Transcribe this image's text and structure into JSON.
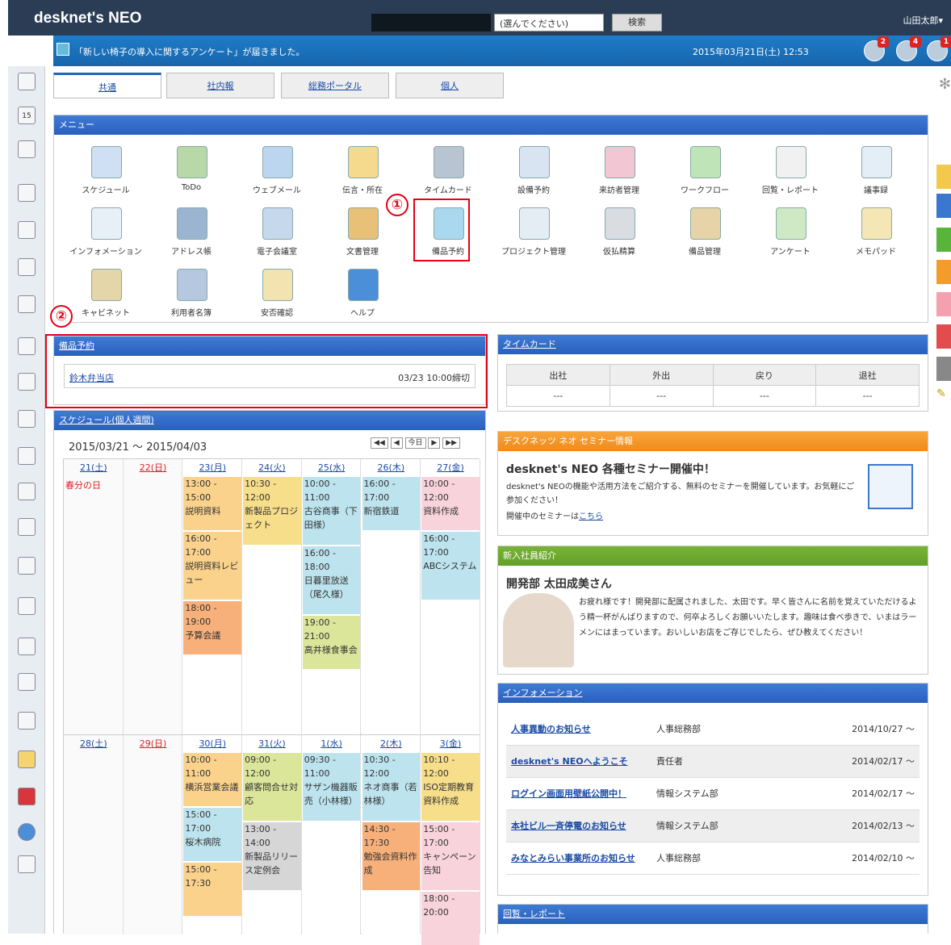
{
  "app": {
    "logo": "desknet's NEO",
    "search_select": "(選んでください)",
    "search_button": "検索",
    "user": "山田太郎▾"
  },
  "notice": {
    "message": "「新しい椅子の導入に関するアンケート」が届きました。",
    "datetime": "2015年03月21日(土) 12:53",
    "badges": [
      "2",
      "4",
      "1"
    ]
  },
  "tabs": [
    "共通",
    "社内報",
    "総務ポータル",
    "個人"
  ],
  "menu": {
    "title": "メニュー",
    "items": [
      {
        "label": "スケジュール",
        "color": "#cfe0f5"
      },
      {
        "label": "ToDo",
        "color": "#b9d8a8"
      },
      {
        "label": "ウェブメール",
        "color": "#bcd6ef"
      },
      {
        "label": "伝言・所在",
        "color": "#f5d98c"
      },
      {
        "label": "タイムカード",
        "color": "#b8c4d2"
      },
      {
        "label": "設備予約",
        "color": "#d8e4f2"
      },
      {
        "label": "来訪者管理",
        "color": "#f3c6d3"
      },
      {
        "label": "ワークフロー",
        "color": "#bfe4b8"
      },
      {
        "label": "回覧・レポート",
        "color": "#f1f1f1"
      },
      {
        "label": "議事録",
        "color": "#e4eef7"
      },
      {
        "label": "インフォメーション",
        "color": "#e8f0f7"
      },
      {
        "label": "アドレス帳",
        "color": "#9bb5d0"
      },
      {
        "label": "電子会議室",
        "color": "#c5d8ec"
      },
      {
        "label": "文書管理",
        "color": "#e8c077"
      },
      {
        "label": "備品予約",
        "color": "#a9d8ef"
      },
      {
        "label": "プロジェクト管理",
        "color": "#e4ecf4"
      },
      {
        "label": "仮払精算",
        "color": "#d9dde2"
      },
      {
        "label": "備品管理",
        "color": "#e7d3a8"
      },
      {
        "label": "アンケート",
        "color": "#cfe9c5"
      },
      {
        "label": "メモパッド",
        "color": "#f5e6b5"
      },
      {
        "label": "キャビネット",
        "color": "#e4d6a8"
      },
      {
        "label": "利用者名簿",
        "color": "#b5c8e0"
      },
      {
        "label": "安否確認",
        "color": "#f2e3b0"
      },
      {
        "label": "ヘルプ",
        "color": "#4a8fd8"
      }
    ]
  },
  "annot": {
    "one": "①",
    "two": "②"
  },
  "equip": {
    "title": "備品予約",
    "item": "鈴木弁当店",
    "time": "03/23 10:00締切"
  },
  "timecard": {
    "title": "タイムカード",
    "cols": [
      "出社",
      "外出",
      "戻り",
      "退社"
    ],
    "vals": [
      "---",
      "---",
      "---",
      "---"
    ]
  },
  "sched": {
    "title": "スケジュール(個人週間)",
    "range": "2015/03/21 ～ 2015/04/03",
    "today": "今日",
    "week1": [
      "21(土)",
      "22(日)",
      "23(月)",
      "24(火)",
      "25(水)",
      "26(木)",
      "27(金)"
    ],
    "week2": [
      "28(土)",
      "29(日)",
      "30(月)",
      "31(火)",
      "1(水)",
      "2(木)",
      "3(金)"
    ],
    "holiday": "春分の日",
    "w1ev": [
      {
        "c": 2,
        "t": "13:00 - 15:00",
        "s": "説明資料",
        "col": "#fad28c"
      },
      {
        "c": 2,
        "t": "16:00 - 17:00",
        "s": "説明資料レビュー",
        "col": "#fad28c"
      },
      {
        "c": 2,
        "t": "18:00 - 19:00",
        "s": "予算会議",
        "col": "#f7b07a"
      },
      {
        "c": 3,
        "t": "10:30 - 12:00",
        "s": "新製品プロジェクト",
        "col": "#f7de8a"
      },
      {
        "c": 4,
        "t": "10:00 - 11:00",
        "s": "古谷商事（下田様）",
        "col": "#bce3ee"
      },
      {
        "c": 4,
        "t": "16:00 - 18:00",
        "s": "日暮里放送（尾久様）",
        "col": "#bce3ee"
      },
      {
        "c": 4,
        "t": "19:00 - 21:00",
        "s": "高井様食事会",
        "col": "#dce69a"
      },
      {
        "c": 5,
        "t": "16:00 - 17:00",
        "s": "新宿鉄道",
        "col": "#bce3ee"
      },
      {
        "c": 6,
        "t": "10:00 - 12:00",
        "s": "資料作成",
        "col": "#f9d3dc"
      },
      {
        "c": 6,
        "t": "16:00 - 17:00",
        "s": "ABCシステム",
        "col": "#bce3ee"
      }
    ],
    "w2ev": [
      {
        "c": 2,
        "t": "10:00 - 11:00",
        "s": "横浜営業会議",
        "col": "#fad28c"
      },
      {
        "c": 2,
        "t": "15:00 - 17:00",
        "s": "桜木病院",
        "col": "#bce3ee"
      },
      {
        "c": 2,
        "t": "15:00 - 17:30",
        "s": "",
        "col": "#fad28c"
      },
      {
        "c": 3,
        "t": "09:00 - 12:00",
        "s": "顧客問合せ対応",
        "col": "#dce69a"
      },
      {
        "c": 3,
        "t": "13:00 - 14:00",
        "s": "新製品リリース定例会",
        "col": "#d6d6d6"
      },
      {
        "c": 4,
        "t": "09:30 - 11:00",
        "s": "サザン機器販売（小林様）",
        "col": "#bce3ee"
      },
      {
        "c": 5,
        "t": "10:30 - 12:00",
        "s": "ネオ商事（若林様）",
        "col": "#bce3ee"
      },
      {
        "c": 5,
        "t": "14:30 - 17:30",
        "s": "勉強会資料作成",
        "col": "#f7b07a"
      },
      {
        "c": 6,
        "t": "10:10 - 12:00",
        "s": "ISO定期教育資料作成",
        "col": "#f7de8a"
      },
      {
        "c": 6,
        "t": "15:00 - 17:00",
        "s": "キャンペーン告知",
        "col": "#f9d3dc"
      },
      {
        "c": 6,
        "t": "18:00 - 20:00",
        "s": "",
        "col": "#f9d3dc"
      }
    ]
  },
  "seminar": {
    "title": "デスクネッツ ネオ セミナー情報",
    "head": "desknet's NEO 各種セミナー開催中！",
    "body": "desknet's NEOの機能や活用方法をご紹介する、無料のセミナーを開催しています。お気軽にご参加ください！",
    "link_pre": "開催中のセミナーは",
    "link": "こちら"
  },
  "newcomer": {
    "title": "新入社員紹介",
    "name": "開発部 太田成美さん",
    "body": "お疲れ様です！開発部に配属されました、太田です。早く皆さんに名前を覚えていただけるよう精一杯がんばりますので、何卒よろしくお願いいたします。趣味は食べ歩きで、いまはラーメンにはまっています。おいしいお店をご存じでしたら、ぜひ教えてください！"
  },
  "info": {
    "title": "インフォメーション",
    "rows": [
      {
        "t": "人事異動のお知らせ",
        "d": "人事総務部",
        "dt": "2014/10/27 ～"
      },
      {
        "t": "desknet's NEOへようこそ",
        "d": "責任者",
        "dt": "2014/02/17 ～"
      },
      {
        "t": "ログイン画面用壁紙公開中！",
        "d": "情報システム部",
        "dt": "2014/02/17 ～"
      },
      {
        "t": "本社ビル一斉停電のお知らせ",
        "d": "情報システム部",
        "dt": "2014/02/13 ～"
      },
      {
        "t": "みなとみらい事業所のお知らせ",
        "d": "人事総務部",
        "dt": "2014/02/10 ～"
      }
    ]
  },
  "report": {
    "title": "回覧・レポート"
  }
}
